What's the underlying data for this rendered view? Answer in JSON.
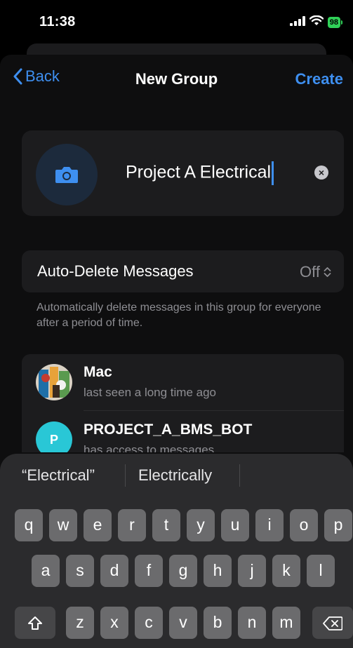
{
  "status_bar": {
    "time": "11:38",
    "battery": "98"
  },
  "nav": {
    "back_label": "Back",
    "title": "New Group",
    "create_label": "Create"
  },
  "group": {
    "name": "Project A Electrical"
  },
  "auto_delete": {
    "label": "Auto-Delete Messages",
    "value": "Off",
    "footnote": "Automatically delete messages in this group for everyone after a period of time."
  },
  "members": [
    {
      "name": "Mac",
      "status": "last seen a long time ago",
      "avatar": "photo-avatar"
    },
    {
      "name": "PROJECT_A_BMS_BOT",
      "status": "has access to messages",
      "initial": "P"
    }
  ],
  "keyboard": {
    "suggestions": [
      "“Electrical”",
      "Electrically"
    ],
    "row1": [
      "q",
      "w",
      "e",
      "r",
      "t",
      "y",
      "u",
      "i",
      "o",
      "p"
    ],
    "row2": [
      "a",
      "s",
      "d",
      "f",
      "g",
      "h",
      "j",
      "k",
      "l"
    ],
    "row3": [
      "z",
      "x",
      "c",
      "v",
      "b",
      "n",
      "m"
    ]
  },
  "colors": {
    "accent": "#3e8ff0",
    "background": "#000000",
    "card": "#1c1c1e",
    "bot_avatar": "#29c7d6",
    "battery": "#30d158"
  }
}
